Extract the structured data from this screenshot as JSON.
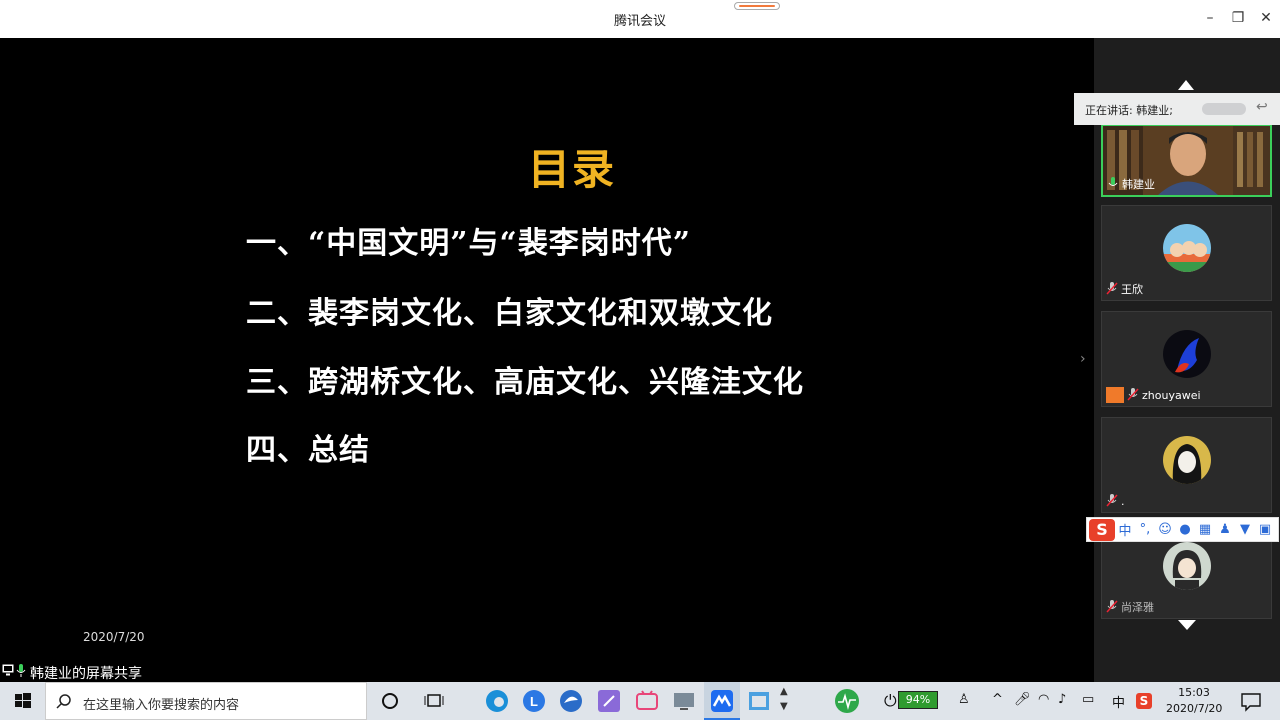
{
  "window": {
    "title": "腾讯会议",
    "min_label": "–",
    "restore_label": "❐",
    "close_label": "✕"
  },
  "slide": {
    "title": "目录",
    "items": [
      "一、“中国文明”与“裴李岗时代”",
      "二、裴李岗文化、白家文化和双墩文化",
      "三、跨湖桥文化、高庙文化、兴隆洼文化",
      "四、总结"
    ],
    "date": "2020/7/20"
  },
  "share": {
    "label": "韩建业的屏幕共享"
  },
  "panel": {
    "speaking_label": "正在讲话: 韩建业;",
    "participants": [
      {
        "name": "韩建业"
      },
      {
        "name": "王欣"
      },
      {
        "name": "zhouyawei"
      },
      {
        "name": "."
      },
      {
        "name": "尚泽雅"
      }
    ]
  },
  "ime": {
    "logo": "S",
    "mode": "中",
    "punct": "°,",
    "buttons": [
      "emoji-icon",
      "mic-icon",
      "keyboard-icon",
      "user-icon",
      "shirt-icon",
      "grid-icon"
    ]
  },
  "taskbar": {
    "search_placeholder": "在这里输入你要搜索的内容",
    "battery": "94%",
    "lang": "中",
    "time": "15:03",
    "date": "2020/7/20"
  },
  "colors": {
    "title_gold": "#f0b322",
    "active_border": "#3bcf5b",
    "progress_orange": "#f27a3d"
  }
}
